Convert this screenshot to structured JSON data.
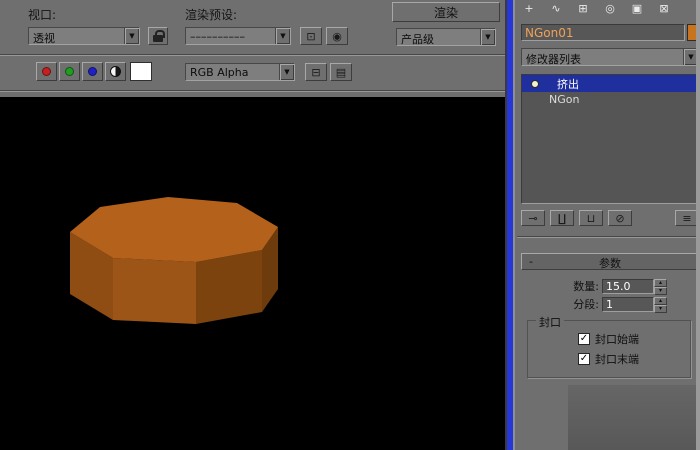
{
  "render_window": {
    "toolbar": {
      "viewport_label": "视口:",
      "viewport_value": "透视",
      "render_presets_label": "渲染预设:",
      "render_presets_value": "––––––––––",
      "render_button": "渲染",
      "render_mode_value": "产品级",
      "channel_value": "RGB Alpha",
      "dropdown_arrow": "▼",
      "render_setup_glyph": "⊡",
      "environment_glyph": "◉",
      "clone_glyph": "⊟",
      "toggle_ui_glyph": "▤",
      "white_swatch": "#ffffff",
      "channel_colors": {
        "red": "#c42020",
        "green": "#1f9e1f",
        "blue": "#2020c4"
      }
    },
    "viewport": {
      "background": "#000000",
      "object_colors": {
        "top": "#b4611c",
        "left": "#8f4d14",
        "front": "#9d5517",
        "right": "#7c430f",
        "far_right": "#6e3b0c"
      }
    }
  },
  "command_panel": {
    "accent_blue": "#2636d8",
    "tabs": [
      {
        "name": "create-tab",
        "glyph": "+"
      },
      {
        "name": "modify-tab",
        "glyph": "∿"
      },
      {
        "name": "hierarchy-tab",
        "glyph": "⊞"
      },
      {
        "name": "motion-tab",
        "glyph": "◎"
      },
      {
        "name": "display-tab",
        "glyph": "▣"
      },
      {
        "name": "utilities-tab",
        "glyph": "⊠"
      }
    ],
    "object_name": "NGon01",
    "object_color": "#c8731e",
    "modifier_list_label": "修改器列表",
    "modifier_stack": [
      {
        "label": "挤出",
        "selected": true
      },
      {
        "label": "NGon",
        "selected": false
      }
    ],
    "stack_tools": [
      {
        "name": "pin-stack",
        "glyph": "⊸"
      },
      {
        "name": "show-end-result",
        "glyph": "∐"
      },
      {
        "name": "make-unique",
        "glyph": "⊔"
      },
      {
        "name": "remove-modifier",
        "glyph": "⊘"
      },
      {
        "name": "configure-modifier-sets",
        "glyph": "≡"
      }
    ],
    "parameters": {
      "collapse_glyph": "-",
      "title": "参数",
      "amount_label": "数量:",
      "amount_value": "15.0",
      "segments_label": "分段:",
      "segments_value": "1",
      "cap_group_label": "封口",
      "cap_start_label": "封口始端",
      "cap_end_label": "封口末端",
      "checkbox_glyph": "✓",
      "spinner_up": "▴",
      "spinner_down": "▾"
    }
  }
}
